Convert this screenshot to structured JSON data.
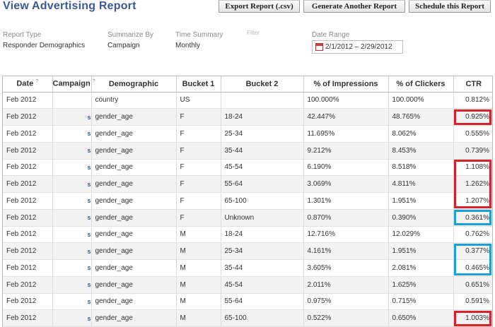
{
  "header": {
    "title": "View Advertising Report",
    "buttons": {
      "export": "Export Report (.csv)",
      "generate": "Generate Another Report",
      "schedule": "Schedule this Report"
    }
  },
  "summary": {
    "report_type": {
      "label": "Report Type",
      "value": "Responder Demographics"
    },
    "summarize_by": {
      "label": "Summarize By",
      "value": "Campaign"
    },
    "time_summary": {
      "label": "Time Summary",
      "value": "Monthly"
    },
    "filter": {
      "label": "Filter"
    },
    "date_range": {
      "label": "Date Range",
      "value": "2/1/2012 – 2/29/2012"
    }
  },
  "table": {
    "columns": [
      "Date",
      "Campaign",
      "Demographic",
      "Bucket 1",
      "Bucket 2",
      "% of Impressions",
      "% of Clickers",
      "CTR"
    ],
    "column_help_marker": "?",
    "rows": [
      {
        "date": "Feb 2012",
        "campaign": "",
        "demographic": "country",
        "bucket1": "US",
        "bucket2": "",
        "impressions": "100.000%",
        "clickers": "100.000%",
        "ctr": "0.812%",
        "highlight": "none"
      },
      {
        "date": "Feb 2012",
        "campaign": "s",
        "demographic": "gender_age",
        "bucket1": "F",
        "bucket2": "18-24",
        "impressions": "42.447%",
        "clickers": "48.765%",
        "ctr": "0.925%",
        "highlight": "red"
      },
      {
        "date": "Feb 2012",
        "campaign": "s",
        "demographic": "gender_age",
        "bucket1": "F",
        "bucket2": "25-34",
        "impressions": "11.695%",
        "clickers": "8.062%",
        "ctr": "0.555%",
        "highlight": "none"
      },
      {
        "date": "Feb 2012",
        "campaign": "s",
        "demographic": "gender_age",
        "bucket1": "F",
        "bucket2": "35-44",
        "impressions": "9.212%",
        "clickers": "8.453%",
        "ctr": "0.739%",
        "highlight": "none"
      },
      {
        "date": "Feb 2012",
        "campaign": "s",
        "demographic": "gender_age",
        "bucket1": "F",
        "bucket2": "45-54",
        "impressions": "6.190%",
        "clickers": "8.518%",
        "ctr": "1.108%",
        "highlight": "red"
      },
      {
        "date": "Feb 2012",
        "campaign": "s",
        "demographic": "gender_age",
        "bucket1": "F",
        "bucket2": "55-64",
        "impressions": "3.069%",
        "clickers": "4.811%",
        "ctr": "1.262%",
        "highlight": "red"
      },
      {
        "date": "Feb 2012",
        "campaign": "s",
        "demographic": "gender_age",
        "bucket1": "F",
        "bucket2": "65-100",
        "impressions": "1.301%",
        "clickers": "1.951%",
        "ctr": "1.207%",
        "highlight": "red"
      },
      {
        "date": "Feb 2012",
        "campaign": "s",
        "demographic": "gender_age",
        "bucket1": "F",
        "bucket2": "Unknown",
        "impressions": "0.870%",
        "clickers": "0.390%",
        "ctr": "0.361%",
        "highlight": "blue"
      },
      {
        "date": "Feb 2012",
        "campaign": "s",
        "demographic": "gender_age",
        "bucket1": "M",
        "bucket2": "18-24",
        "impressions": "12.716%",
        "clickers": "12.029%",
        "ctr": "0.762%",
        "highlight": "none"
      },
      {
        "date": "Feb 2012",
        "campaign": "s",
        "demographic": "gender_age",
        "bucket1": "M",
        "bucket2": "25-34",
        "impressions": "4.161%",
        "clickers": "1.951%",
        "ctr": "0.377%",
        "highlight": "blue"
      },
      {
        "date": "Feb 2012",
        "campaign": "s",
        "demographic": "gender_age",
        "bucket1": "M",
        "bucket2": "35-44",
        "impressions": "3.605%",
        "clickers": "2.081%",
        "ctr": "0.465%",
        "highlight": "blue"
      },
      {
        "date": "Feb 2012",
        "campaign": "s",
        "demographic": "gender_age",
        "bucket1": "M",
        "bucket2": "45-54",
        "impressions": "2.011%",
        "clickers": "1.625%",
        "ctr": "0.651%",
        "highlight": "none"
      },
      {
        "date": "Feb 2012",
        "campaign": "s",
        "demographic": "gender_age",
        "bucket1": "M",
        "bucket2": "55-64",
        "impressions": "0.975%",
        "clickers": "0.715%",
        "ctr": "0.591%",
        "highlight": "none"
      },
      {
        "date": "Feb 2012",
        "campaign": "s",
        "demographic": "gender_age",
        "bucket1": "M",
        "bucket2": "65-100",
        "impressions": "0.522%",
        "clickers": "0.650%",
        "ctr": "1.003%",
        "highlight": "red"
      }
    ]
  },
  "colors": {
    "title": "#3b5998",
    "highlight_red": "#d8222a",
    "highlight_blue": "#1ba1d8",
    "zebra": "#f3f3f3"
  },
  "icons": {
    "date_range": "calendar-icon"
  }
}
